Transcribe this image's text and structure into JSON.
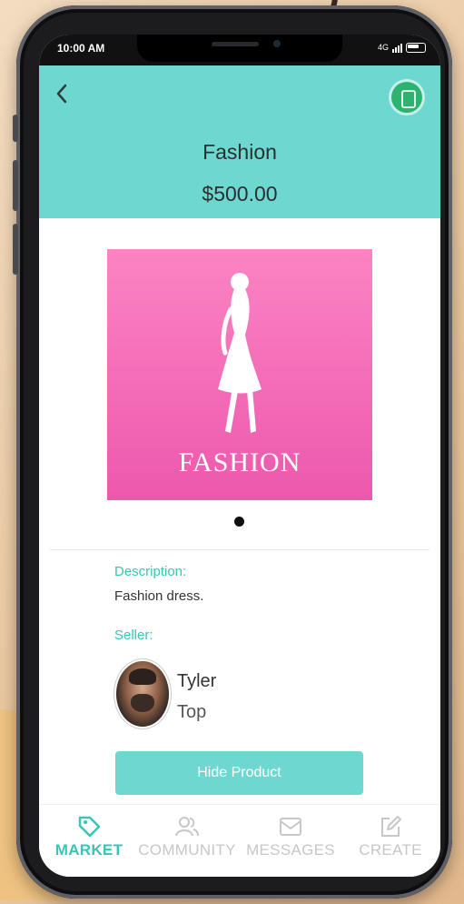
{
  "status_bar": {
    "time": "10:00 AM",
    "network": "4G"
  },
  "header": {
    "title": "Fashion",
    "price": "$500.00"
  },
  "product": {
    "image_text": "FASHION",
    "images_count": 1
  },
  "description": {
    "label": "Description:",
    "value": "Fashion dress."
  },
  "seller": {
    "label": "Seller:",
    "first_name": "Tyler",
    "last_name": "Top"
  },
  "actions": {
    "hide_label": "Hide Product"
  },
  "nav": {
    "market": "MARKET",
    "community": "COMMUNITY",
    "messages": "MESSAGES",
    "create": "CREATE",
    "active": "market"
  },
  "colors": {
    "accent": "#6ed8d0",
    "accent_text": "#39c4b8",
    "product_bg": "#f066b4"
  }
}
